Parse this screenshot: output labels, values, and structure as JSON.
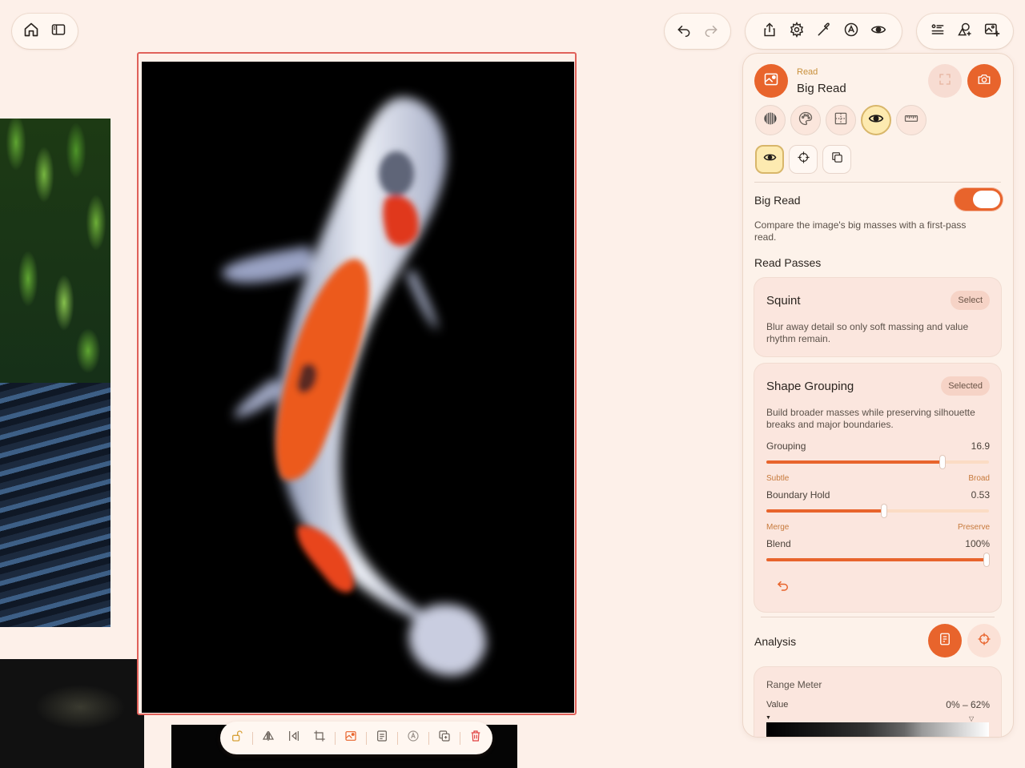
{
  "panel": {
    "header": {
      "subtitle": "Read",
      "title": "Big Read"
    },
    "big_read": {
      "label": "Big Read",
      "enabled": true,
      "description": "Compare the image's big masses with a first-pass read."
    },
    "passes_heading": "Read Passes",
    "passes": [
      {
        "title": "Squint",
        "chip": "Select",
        "description": "Blur away detail so only soft massing and value rhythm remain."
      },
      {
        "title": "Shape Grouping",
        "chip": "Selected",
        "description": "Build broader masses while preserving silhouette breaks and major boundaries.",
        "sliders": [
          {
            "label": "Grouping",
            "value": "16.9",
            "fraction": 0.79,
            "min_label": "Subtle",
            "max_label": "Broad"
          },
          {
            "label": "Boundary Hold",
            "value": "0.53",
            "fraction": 0.53,
            "min_label": "Merge",
            "max_label": "Preserve"
          },
          {
            "label": "Blend",
            "value": "100%",
            "fraction": 1.0
          }
        ]
      }
    ],
    "analysis": {
      "heading": "Analysis",
      "range_meter": {
        "title": "Range Meter",
        "label": "Value",
        "value": "0% – 62%"
      }
    }
  },
  "colors": {
    "accent": "#e8642c",
    "selection_border": "#e0615a",
    "background": "#fdf0e9",
    "delete": "#e04040"
  },
  "icons": {
    "top_left": [
      "home-icon",
      "sidebar-icon"
    ],
    "history": [
      "undo-icon",
      "redo-icon"
    ],
    "tools": [
      "share-icon",
      "settings-icon",
      "eyedropper-icon",
      "shapes-text-icon",
      "eye-icon"
    ],
    "right": [
      "list-icon",
      "shapes-add-icon",
      "image-add-icon"
    ],
    "modes": [
      "texture-icon",
      "palette-icon",
      "grid-icon",
      "eye-icon",
      "ruler-icon"
    ],
    "sub_modes": [
      "eye-icon",
      "crosshair-icon",
      "copy-icon"
    ],
    "image_toolbar": [
      "unlock-icon",
      "flip-icon",
      "align-icon",
      "crop-icon",
      "image-read-icon",
      "notes-icon",
      "text-icon",
      "duplicate-icon",
      "trash-icon"
    ]
  }
}
